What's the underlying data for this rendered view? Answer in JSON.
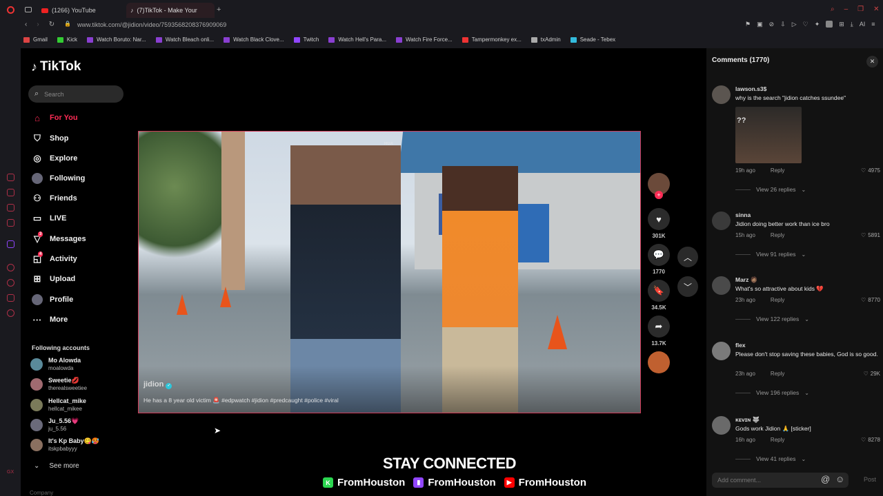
{
  "browser": {
    "tabs": [
      {
        "label": "(1266) YouTube",
        "icon": "youtube-icon"
      },
      {
        "label": "(7)TikTok - Make Your",
        "icon": "tiktok-icon"
      }
    ],
    "new_tab": "+",
    "url": "www.tiktok.com/@jidion/video/7593568208376909069",
    "ai_label": "AI",
    "bookmarks": [
      {
        "label": "Gmail",
        "color": "#d44"
      },
      {
        "label": "Kick",
        "color": "#3c3"
      },
      {
        "label": "Watch Boruto: Nar...",
        "color": "#8a3fd1"
      },
      {
        "label": "Watch Bleach onli...",
        "color": "#8a3fd1"
      },
      {
        "label": "Watch Black Clove...",
        "color": "#8a3fd1"
      },
      {
        "label": "Twitch",
        "color": "#9146ff"
      },
      {
        "label": "Watch Hell's Para...",
        "color": "#8a3fd1"
      },
      {
        "label": "Watch Fire Force...",
        "color": "#8a3fd1"
      },
      {
        "label": "Tampermonkey ex...",
        "color": "#e33"
      },
      {
        "label": "txAdmin",
        "color": "#aaa"
      },
      {
        "label": "Seade - Tebex",
        "color": "#3bd"
      }
    ]
  },
  "sidebar": {
    "logo": "TikTok",
    "search_placeholder": "Search",
    "nav": [
      {
        "label": "For You",
        "icon": "home-icon",
        "active": true
      },
      {
        "label": "Shop",
        "icon": "shop-icon"
      },
      {
        "label": "Explore",
        "icon": "compass-icon"
      },
      {
        "label": "Following",
        "icon": "following-avatar-icon"
      },
      {
        "label": "Friends",
        "icon": "friends-icon"
      },
      {
        "label": "LIVE",
        "icon": "live-icon"
      },
      {
        "label": "Messages",
        "icon": "messages-icon",
        "badge": "3"
      },
      {
        "label": "Activity",
        "icon": "activity-icon",
        "badge": "4"
      },
      {
        "label": "Upload",
        "icon": "upload-icon"
      },
      {
        "label": "Profile",
        "icon": "profile-avatar-icon"
      },
      {
        "label": "More",
        "icon": "more-icon"
      }
    ],
    "following_title": "Following accounts",
    "following": [
      {
        "name": "Mo Alowda",
        "handle": "moalowda"
      },
      {
        "name": "Sweetie💋",
        "handle": "therealsweetiee"
      },
      {
        "name": "Hellcat_mike",
        "handle": "hellcat_mikee"
      },
      {
        "name": "Ju_5.56💗",
        "handle": "ju_5.56"
      },
      {
        "name": "It's Kp Baby😋🥵",
        "handle": "itskpbabyyy"
      }
    ],
    "see_more": "See more",
    "company": "Company"
  },
  "video": {
    "watermark": "RGX",
    "user": "jidion",
    "caption": "He has a 8 year old victim 🚨 #edpwatch #jidion #predcaught #police #viral",
    "likes": "301K",
    "comments": "1770",
    "saves": "34.5K",
    "shares": "13.7K"
  },
  "banner": {
    "title": "STAY CONNECTED",
    "handles": [
      "FromHouston",
      "FromHouston",
      "FromHouston"
    ]
  },
  "comments": {
    "title": "Comments (1770)",
    "items": [
      {
        "user": "lawson.s3$",
        "text": "why is the search \"jidion catches ssundee\"",
        "time": "19h ago",
        "reply": "Reply",
        "likes": "4975",
        "replies": "View 26 replies",
        "sticker_text": "??"
      },
      {
        "user": "sinna",
        "text": "Jidion doing better work than ice bro",
        "time": "15h ago",
        "reply": "Reply",
        "likes": "5891",
        "replies": "View 91 replies"
      },
      {
        "user": "Marz 🧔🏽",
        "text": "What's so attractive about kids 💔",
        "time": "23h ago",
        "reply": "Reply",
        "likes": "8770",
        "replies": "View 122 replies"
      },
      {
        "user": "flex",
        "text": "Please don't stop saving these babies, God is so good.",
        "time": "23h ago",
        "reply": "Reply",
        "likes": "29K",
        "replies": "View 196 replies"
      },
      {
        "user": "ᴋᴇᴠɪɴ 🐺",
        "text": "Gods work Jidion 🙏 [sticker]",
        "time": "16h ago",
        "reply": "Reply",
        "likes": "8278",
        "replies": "View 41 replies"
      }
    ],
    "add_placeholder": "Add comment...",
    "post": "Post"
  }
}
